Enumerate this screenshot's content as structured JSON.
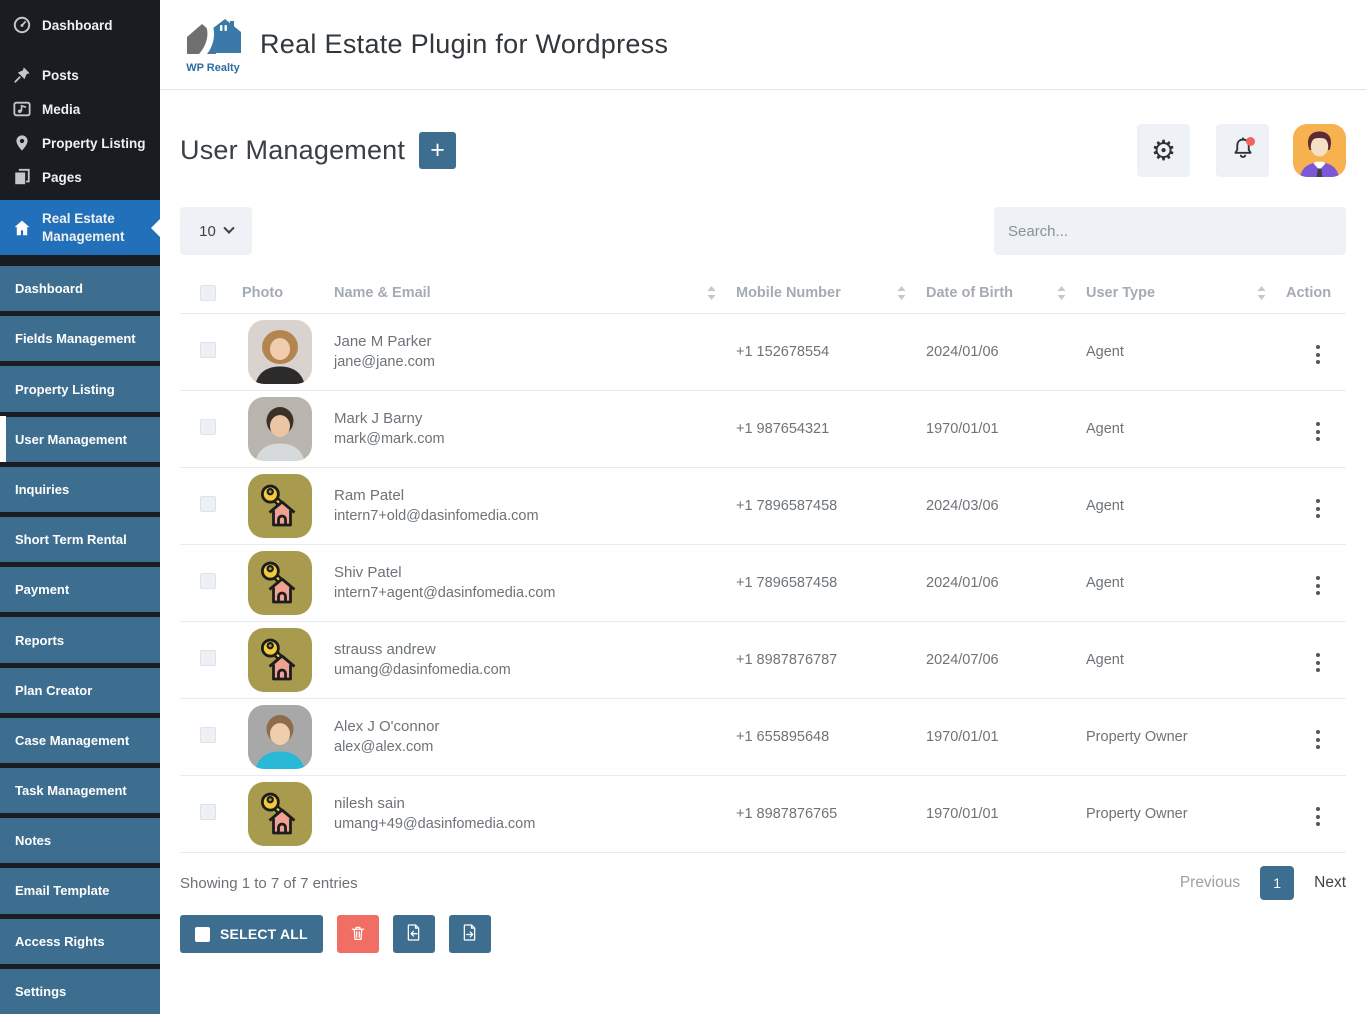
{
  "sidebar": {
    "main_items": [
      {
        "label": "Dashboard",
        "icon": "gauge-icon",
        "active": false
      },
      {
        "label": "Posts",
        "icon": "pushpin-icon",
        "active": false
      },
      {
        "label": "Media",
        "icon": "media-icon",
        "active": false
      },
      {
        "label": "Property Listing",
        "icon": "map-pin-icon",
        "active": false
      },
      {
        "label": "Pages",
        "icon": "pages-icon",
        "active": false
      },
      {
        "label": "Real Estate Management",
        "icon": "house-icon",
        "active": true
      }
    ],
    "sub_items": [
      {
        "label": "Dashboard",
        "active": false
      },
      {
        "label": "Fields Management",
        "active": false
      },
      {
        "label": "Property Listing",
        "active": false
      },
      {
        "label": "User Management",
        "active": true
      },
      {
        "label": "Inquiries",
        "active": false
      },
      {
        "label": "Short Term Rental",
        "active": false
      },
      {
        "label": "Payment",
        "active": false
      },
      {
        "label": "Reports",
        "active": false
      },
      {
        "label": "Plan Creator",
        "active": false
      },
      {
        "label": "Case Management",
        "active": false
      },
      {
        "label": "Task Management",
        "active": false
      },
      {
        "label": "Notes",
        "active": false
      },
      {
        "label": "Email Template",
        "active": false
      },
      {
        "label": "Access Rights",
        "active": false
      },
      {
        "label": "Settings",
        "active": false
      }
    ]
  },
  "header": {
    "logo_text": "WP Realty",
    "title": "Real Estate Plugin for Wordpress"
  },
  "page": {
    "title": "User Management",
    "add_button_label": "+"
  },
  "controls": {
    "page_size": "10",
    "search_placeholder": "Search..."
  },
  "table": {
    "columns": [
      "Photo",
      "Name & Email",
      "Mobile Number",
      "Date of Birth",
      "User Type",
      "Action"
    ],
    "rows": [
      {
        "name": "Jane M Parker",
        "email": "jane@jane.com",
        "mobile": "+1 152678554",
        "dob": "2024/01/06",
        "user_type": "Agent",
        "photo": {
          "kind": "person",
          "bg": "#d8d3ce",
          "hair": "#b5854f",
          "skin": "#f0cdad",
          "shirt": "#2b2b2b",
          "curly": true
        }
      },
      {
        "name": "Mark J Barny",
        "email": "mark@mark.com",
        "mobile": "+1 987654321",
        "dob": "1970/01/01",
        "user_type": "Agent",
        "photo": {
          "kind": "person",
          "bg": "#b9b4ae",
          "hair": "#3b3128",
          "skin": "#ecc6a2",
          "shirt": "#d7dadb",
          "curly": false
        }
      },
      {
        "name": "Ram Patel",
        "email": "intern7+old@dasinfomedia.com",
        "mobile": "+1 7896587458",
        "dob": "2024/03/06",
        "user_type": "Agent",
        "photo": {
          "kind": "default-key-house",
          "bg": "#a89b4e"
        }
      },
      {
        "name": "Shiv Patel",
        "email": "intern7+agent@dasinfomedia.com",
        "mobile": "+1 7896587458",
        "dob": "2024/01/06",
        "user_type": "Agent",
        "photo": {
          "kind": "default-key-house",
          "bg": "#a89b4e"
        }
      },
      {
        "name": "strauss andrew",
        "email": "umang@dasinfomedia.com",
        "mobile": "+1 8987876787",
        "dob": "2024/07/06",
        "user_type": "Agent",
        "photo": {
          "kind": "default-key-house",
          "bg": "#a89b4e"
        }
      },
      {
        "name": "Alex J O'connor",
        "email": "alex@alex.com",
        "mobile": "+1 655895648",
        "dob": "1970/01/01",
        "user_type": "Property Owner",
        "photo": {
          "kind": "person",
          "bg": "#a8a8a8",
          "hair": "#8d6e4a",
          "skin": "#f0cdad",
          "shirt": "#29b9d6",
          "curly": false
        }
      },
      {
        "name": "nilesh sain",
        "email": "umang+49@dasinfomedia.com",
        "mobile": "+1 8987876765",
        "dob": "1970/01/01",
        "user_type": "Property Owner",
        "photo": {
          "kind": "default-key-house",
          "bg": "#a89b4e"
        }
      }
    ]
  },
  "footer": {
    "showing_text": "Showing 1 to 7 of 7 entries",
    "previous_label": "Previous",
    "current_page": "1",
    "next_label": "Next",
    "select_all_label": "SELECT ALL"
  },
  "colors": {
    "accent": "#3d6e8f",
    "sidebar_active_blue": "#2170b9",
    "sidebar_dark": "#191d22",
    "danger": "#f06e63",
    "notification_dot": "#f3645c",
    "avatar_bg": "#f7b14f",
    "default_photo_bg": "#a89b4e",
    "light_box": "#eef1f6"
  }
}
